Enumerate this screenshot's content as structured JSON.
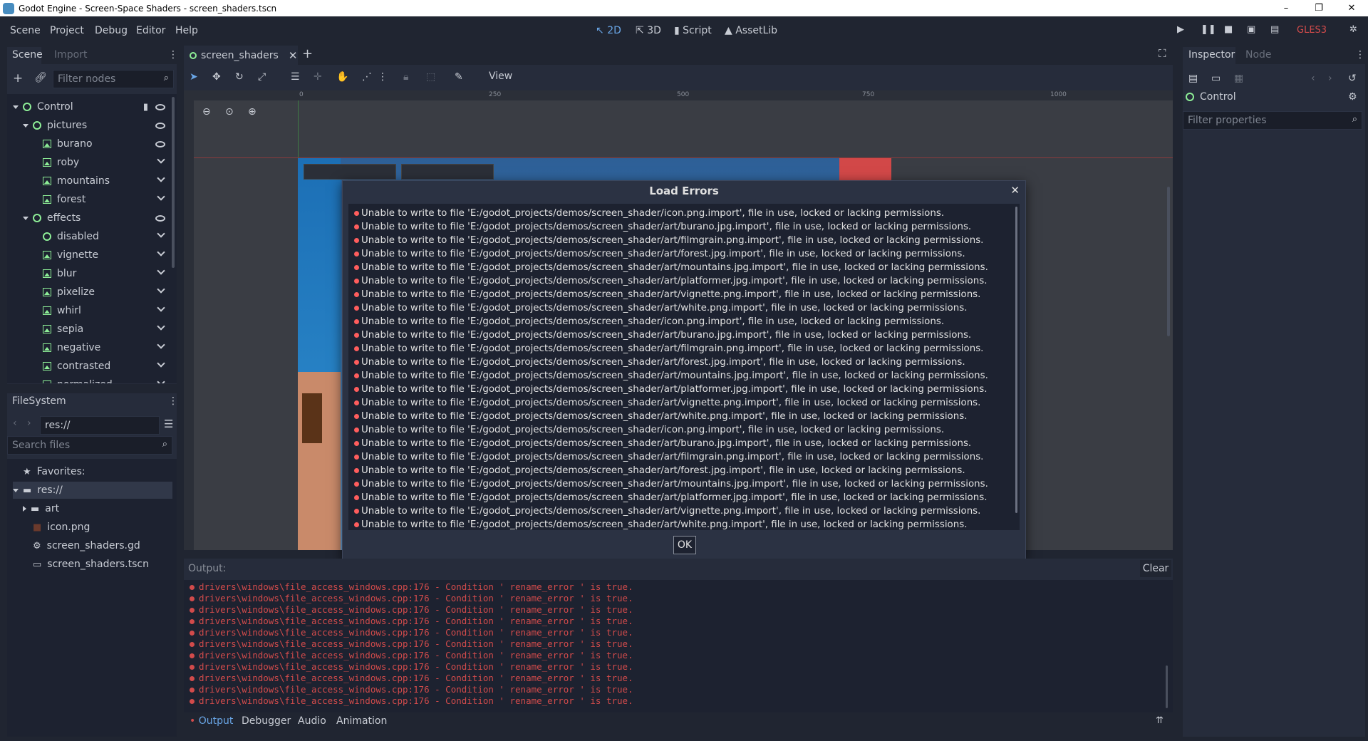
{
  "window": {
    "title": "Godot Engine - Screen-Space Shaders - screen_shaders.tscn",
    "minimize": "–",
    "maximize": "❐",
    "close": "✕"
  },
  "menu": [
    "Scene",
    "Project",
    "Debug",
    "Editor",
    "Help"
  ],
  "modes": {
    "two_d": "2D",
    "three_d": "3D",
    "script": "Script",
    "assetlib": "AssetLib"
  },
  "renderer": "GLES3",
  "scene_dock": {
    "tabs": [
      "Scene",
      "Import"
    ],
    "filter_placeholder": "Filter nodes",
    "tree": [
      {
        "label": "Control",
        "depth": 0,
        "kind": "node",
        "expander": "down",
        "vis": "eye"
      },
      {
        "label": "pictures",
        "depth": 1,
        "kind": "node",
        "expander": "down",
        "vis": "eye"
      },
      {
        "label": "burano",
        "depth": 2,
        "kind": "tex",
        "vis": "eye"
      },
      {
        "label": "roby",
        "depth": 2,
        "kind": "tex",
        "vis": "chev"
      },
      {
        "label": "mountains",
        "depth": 2,
        "kind": "tex",
        "vis": "chev"
      },
      {
        "label": "forest",
        "depth": 2,
        "kind": "tex",
        "vis": "chev"
      },
      {
        "label": "effects",
        "depth": 1,
        "kind": "node",
        "expander": "down",
        "vis": "eye"
      },
      {
        "label": "disabled",
        "depth": 2,
        "kind": "node",
        "vis": "chev"
      },
      {
        "label": "vignette",
        "depth": 2,
        "kind": "tex",
        "vis": "chev"
      },
      {
        "label": "blur",
        "depth": 2,
        "kind": "tex",
        "vis": "chev"
      },
      {
        "label": "pixelize",
        "depth": 2,
        "kind": "tex",
        "vis": "chev"
      },
      {
        "label": "whirl",
        "depth": 2,
        "kind": "tex",
        "vis": "chev"
      },
      {
        "label": "sepia",
        "depth": 2,
        "kind": "tex",
        "vis": "chev"
      },
      {
        "label": "negative",
        "depth": 2,
        "kind": "tex",
        "vis": "chev"
      },
      {
        "label": "contrasted",
        "depth": 2,
        "kind": "tex",
        "vis": "chev"
      },
      {
        "label": "normalized",
        "depth": 2,
        "kind": "tex",
        "vis": "chev"
      }
    ]
  },
  "filesystem": {
    "title": "FileSystem",
    "path": "res://",
    "search_placeholder": "Search files",
    "items": [
      {
        "label": "Favorites:",
        "kind": "star",
        "depth": 0
      },
      {
        "label": "res://",
        "kind": "folder",
        "depth": 0,
        "expander": "down"
      },
      {
        "label": "art",
        "kind": "folder",
        "depth": 1,
        "expander": "right"
      },
      {
        "label": "icon.png",
        "kind": "image",
        "depth": 1
      },
      {
        "label": "screen_shaders.gd",
        "kind": "gear",
        "depth": 1
      },
      {
        "label": "screen_shaders.tscn",
        "kind": "scene",
        "depth": 1
      }
    ]
  },
  "editor": {
    "scene_tab": "screen_shaders",
    "view_label": "View",
    "ruler_labels": [
      "0",
      "250",
      "500",
      "750",
      "1000"
    ]
  },
  "dialog": {
    "title": "Load Errors",
    "ok_label": "OK",
    "errors": [
      "Unable to write to file 'E:/godot_projects/demos/screen_shader/icon.png.import', file in use, locked or lacking permissions.",
      "Unable to write to file 'E:/godot_projects/demos/screen_shader/art/burano.jpg.import', file in use, locked or lacking permissions.",
      "Unable to write to file 'E:/godot_projects/demos/screen_shader/art/filmgrain.png.import', file in use, locked or lacking permissions.",
      "Unable to write to file 'E:/godot_projects/demos/screen_shader/art/forest.jpg.import', file in use, locked or lacking permissions.",
      "Unable to write to file 'E:/godot_projects/demos/screen_shader/art/mountains.jpg.import', file in use, locked or lacking permissions.",
      "Unable to write to file 'E:/godot_projects/demos/screen_shader/art/platformer.jpg.import', file in use, locked or lacking permissions.",
      "Unable to write to file 'E:/godot_projects/demos/screen_shader/art/vignette.png.import', file in use, locked or lacking permissions.",
      "Unable to write to file 'E:/godot_projects/demos/screen_shader/art/white.png.import', file in use, locked or lacking permissions.",
      "Unable to write to file 'E:/godot_projects/demos/screen_shader/icon.png.import', file in use, locked or lacking permissions.",
      "Unable to write to file 'E:/godot_projects/demos/screen_shader/art/burano.jpg.import', file in use, locked or lacking permissions.",
      "Unable to write to file 'E:/godot_projects/demos/screen_shader/art/filmgrain.png.import', file in use, locked or lacking permissions.",
      "Unable to write to file 'E:/godot_projects/demos/screen_shader/art/forest.jpg.import', file in use, locked or lacking permissions.",
      "Unable to write to file 'E:/godot_projects/demos/screen_shader/art/mountains.jpg.import', file in use, locked or lacking permissions.",
      "Unable to write to file 'E:/godot_projects/demos/screen_shader/art/platformer.jpg.import', file in use, locked or lacking permissions.",
      "Unable to write to file 'E:/godot_projects/demos/screen_shader/art/vignette.png.import', file in use, locked or lacking permissions.",
      "Unable to write to file 'E:/godot_projects/demos/screen_shader/art/white.png.import', file in use, locked or lacking permissions.",
      "Unable to write to file 'E:/godot_projects/demos/screen_shader/icon.png.import', file in use, locked or lacking permissions.",
      "Unable to write to file 'E:/godot_projects/demos/screen_shader/art/burano.jpg.import', file in use, locked or lacking permissions.",
      "Unable to write to file 'E:/godot_projects/demos/screen_shader/art/filmgrain.png.import', file in use, locked or lacking permissions.",
      "Unable to write to file 'E:/godot_projects/demos/screen_shader/art/forest.jpg.import', file in use, locked or lacking permissions.",
      "Unable to write to file 'E:/godot_projects/demos/screen_shader/art/mountains.jpg.import', file in use, locked or lacking permissions.",
      "Unable to write to file 'E:/godot_projects/demos/screen_shader/art/platformer.jpg.import', file in use, locked or lacking permissions.",
      "Unable to write to file 'E:/godot_projects/demos/screen_shader/art/vignette.png.import', file in use, locked or lacking permissions.",
      "Unable to write to file 'E:/godot_projects/demos/screen_shader/art/white.png.import', file in use, locked or lacking permissions."
    ]
  },
  "output": {
    "label": "Output:",
    "clear_label": "Clear",
    "lines": [
      "drivers\\windows\\file_access_windows.cpp:176 - Condition ' rename_error ' is true.",
      "drivers\\windows\\file_access_windows.cpp:176 - Condition ' rename_error ' is true.",
      "drivers\\windows\\file_access_windows.cpp:176 - Condition ' rename_error ' is true.",
      "drivers\\windows\\file_access_windows.cpp:176 - Condition ' rename_error ' is true.",
      "drivers\\windows\\file_access_windows.cpp:176 - Condition ' rename_error ' is true.",
      "drivers\\windows\\file_access_windows.cpp:176 - Condition ' rename_error ' is true.",
      "drivers\\windows\\file_access_windows.cpp:176 - Condition ' rename_error ' is true.",
      "drivers\\windows\\file_access_windows.cpp:176 - Condition ' rename_error ' is true.",
      "drivers\\windows\\file_access_windows.cpp:176 - Condition ' rename_error ' is true.",
      "drivers\\windows\\file_access_windows.cpp:176 - Condition ' rename_error ' is true.",
      "drivers\\windows\\file_access_windows.cpp:176 - Condition ' rename_error ' is true."
    ]
  },
  "bottom_tabs": [
    "Output",
    "Debugger",
    "Audio",
    "Animation"
  ],
  "inspector": {
    "tabs": [
      "Inspector",
      "Node"
    ],
    "object": "Control",
    "filter_placeholder": "Filter properties"
  },
  "colors": {
    "accent": "#6aa7e8",
    "node_green": "#8eef97",
    "error_red": "#ff5d5d",
    "bg": "#202531",
    "panel": "#262c3b"
  }
}
